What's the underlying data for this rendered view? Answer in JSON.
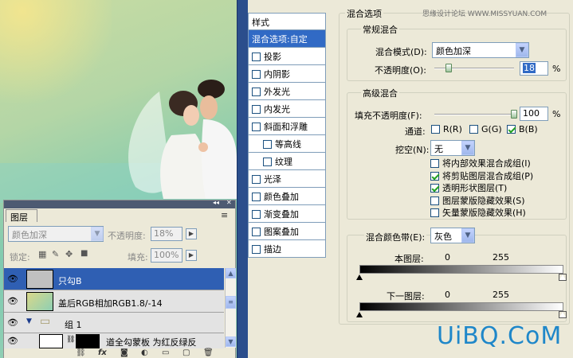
{
  "watermark": "思缘设计论坛 WWW.MISSYUAN.COM",
  "logo": "UiBQ.CoM",
  "styles_panel": {
    "title": "样式",
    "items": [
      {
        "label": "混合选项:自定",
        "checkbox": false,
        "checked": false,
        "selected": true,
        "sub": false
      },
      {
        "label": "投影",
        "checkbox": true,
        "checked": false,
        "selected": false,
        "sub": false
      },
      {
        "label": "内阴影",
        "checkbox": true,
        "checked": false,
        "selected": false,
        "sub": false
      },
      {
        "label": "外发光",
        "checkbox": true,
        "checked": false,
        "selected": false,
        "sub": false
      },
      {
        "label": "内发光",
        "checkbox": true,
        "checked": false,
        "selected": false,
        "sub": false
      },
      {
        "label": "斜面和浮雕",
        "checkbox": true,
        "checked": false,
        "selected": false,
        "sub": false
      },
      {
        "label": "等高线",
        "checkbox": true,
        "checked": false,
        "selected": false,
        "sub": true
      },
      {
        "label": "纹理",
        "checkbox": true,
        "checked": false,
        "selected": false,
        "sub": true
      },
      {
        "label": "光泽",
        "checkbox": true,
        "checked": false,
        "selected": false,
        "sub": false
      },
      {
        "label": "颜色叠加",
        "checkbox": true,
        "checked": false,
        "selected": false,
        "sub": false
      },
      {
        "label": "渐变叠加",
        "checkbox": true,
        "checked": false,
        "selected": false,
        "sub": false
      },
      {
        "label": "图案叠加",
        "checkbox": true,
        "checked": false,
        "selected": false,
        "sub": false
      },
      {
        "label": "描边",
        "checkbox": true,
        "checked": false,
        "selected": false,
        "sub": false
      }
    ]
  },
  "blending": {
    "title": "混合选项",
    "general": {
      "title": "常规混合",
      "mode_label": "混合模式(D):",
      "mode_value": "颜色加深",
      "opacity_label": "不透明度(O):",
      "opacity_value": "18",
      "opacity_pct": 18,
      "percent": "%"
    },
    "advanced": {
      "title": "高级混合",
      "fill_label": "填充不透明度(F):",
      "fill_value": "100",
      "fill_pct": 100,
      "percent": "%",
      "channels_label": "通道:",
      "channel_r": "R(R)",
      "channel_g": "G(G)",
      "channel_b": "B(B)",
      "knockout_label": "挖空(N):",
      "knockout_value": "无",
      "options": [
        {
          "label": "将内部效果混合成组(I)",
          "checked": false
        },
        {
          "label": "将剪贴图层混合成组(P)",
          "checked": true
        },
        {
          "label": "透明形状图层(T)",
          "checked": true
        },
        {
          "label": "图层蒙版隐藏效果(S)",
          "checked": false
        },
        {
          "label": "矢量蒙版隐藏效果(H)",
          "checked": false
        }
      ]
    },
    "blend_if": {
      "label": "混合颜色带(E):",
      "value": "灰色",
      "this_layer_label": "本图层:",
      "this_layer_low": "0",
      "this_layer_high": "255",
      "under_layer_label": "下一图层:",
      "under_layer_low": "0",
      "under_layer_high": "255"
    }
  },
  "layers_panel": {
    "tab": "图层",
    "menu_icon": "≡",
    "blend_mode": "颜色加深",
    "opacity_label": "不透明度:",
    "opacity_value": "18%",
    "lock_label": "锁定:",
    "fill_label": "填充:",
    "fill_value": "100%",
    "rows": [
      {
        "name": "只勾B",
        "selected": true
      },
      {
        "name": "盖后RGB相加RGB1.8/-14",
        "selected": false
      },
      {
        "name": "组 1",
        "selected": false
      },
      {
        "name": "道全勾蒙板 为红反绿反",
        "selected": false
      }
    ],
    "bottom_fx": "fx"
  }
}
